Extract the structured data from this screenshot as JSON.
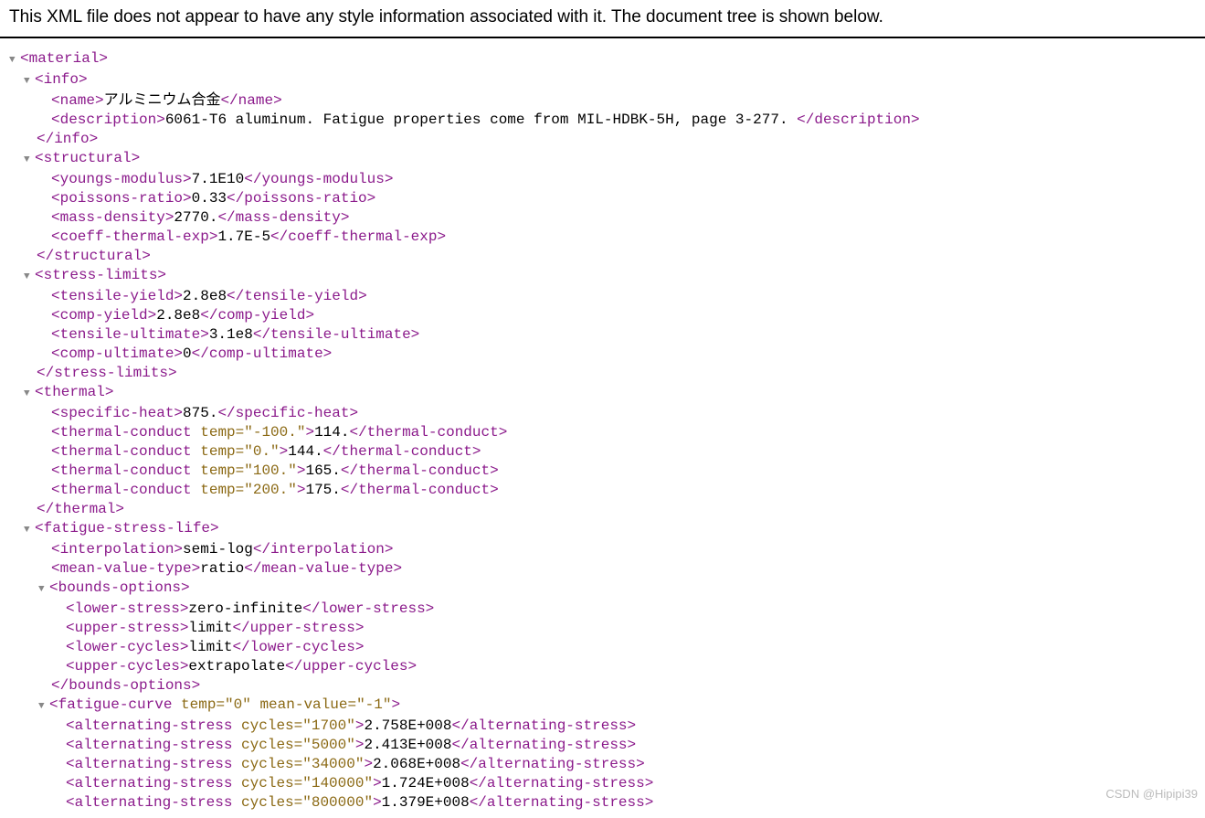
{
  "banner": "This XML file does not appear to have any style information associated with it. The document tree is shown below.",
  "watermark": "CSDN @Hipipi39",
  "tree": [
    {
      "indent": 0,
      "arrow": true,
      "open": "<material>"
    },
    {
      "indent": 1,
      "arrow": true,
      "open": "<info>"
    },
    {
      "indent": 2,
      "open": "<name>",
      "text": "アルミニウム合金",
      "close": "</name>"
    },
    {
      "indent": 2,
      "open": "<description>",
      "text": "6061-T6 aluminum. Fatigue properties come from MIL-HDBK-5H, page 3-277. ",
      "close": "</description>"
    },
    {
      "indent": 1,
      "open": "</info>"
    },
    {
      "indent": 1,
      "arrow": true,
      "open": "<structural>"
    },
    {
      "indent": 2,
      "open": "<youngs-modulus>",
      "text": "7.1E10",
      "close": "</youngs-modulus>"
    },
    {
      "indent": 2,
      "open": "<poissons-ratio>",
      "text": "0.33",
      "close": "</poissons-ratio>"
    },
    {
      "indent": 2,
      "open": "<mass-density>",
      "text": "2770.",
      "close": "</mass-density>"
    },
    {
      "indent": 2,
      "open": "<coeff-thermal-exp>",
      "text": "1.7E-5",
      "close": "</coeff-thermal-exp>"
    },
    {
      "indent": 1,
      "open": "</structural>"
    },
    {
      "indent": 1,
      "arrow": true,
      "open": "<stress-limits>"
    },
    {
      "indent": 2,
      "open": "<tensile-yield>",
      "text": "2.8e8",
      "close": "</tensile-yield>"
    },
    {
      "indent": 2,
      "open": "<comp-yield>",
      "text": "2.8e8",
      "close": "</comp-yield>"
    },
    {
      "indent": 2,
      "open": "<tensile-ultimate>",
      "text": "3.1e8",
      "close": "</tensile-ultimate>"
    },
    {
      "indent": 2,
      "open": "<comp-ultimate>",
      "text": "0",
      "close": "</comp-ultimate>"
    },
    {
      "indent": 1,
      "open": "</stress-limits>"
    },
    {
      "indent": 1,
      "arrow": true,
      "open": "<thermal>"
    },
    {
      "indent": 2,
      "open": "<specific-heat>",
      "text": "875.",
      "close": "</specific-heat>"
    },
    {
      "indent": 2,
      "open": "<thermal-conduct ",
      "attr": "temp=\"-100.\"",
      "openEnd": ">",
      "text": "114.",
      "close": "</thermal-conduct>"
    },
    {
      "indent": 2,
      "open": "<thermal-conduct ",
      "attr": "temp=\"0.\"",
      "openEnd": ">",
      "text": "144.",
      "close": "</thermal-conduct>"
    },
    {
      "indent": 2,
      "open": "<thermal-conduct ",
      "attr": "temp=\"100.\"",
      "openEnd": ">",
      "text": "165.",
      "close": "</thermal-conduct>"
    },
    {
      "indent": 2,
      "open": "<thermal-conduct ",
      "attr": "temp=\"200.\"",
      "openEnd": ">",
      "text": "175.",
      "close": "</thermal-conduct>"
    },
    {
      "indent": 1,
      "open": "</thermal>"
    },
    {
      "indent": 1,
      "arrow": true,
      "open": "<fatigue-stress-life>"
    },
    {
      "indent": 2,
      "open": "<interpolation>",
      "text": "semi-log",
      "close": "</interpolation>"
    },
    {
      "indent": 2,
      "open": "<mean-value-type>",
      "text": "ratio",
      "close": "</mean-value-type>"
    },
    {
      "indent": 2,
      "arrow": true,
      "open": "<bounds-options>"
    },
    {
      "indent": 3,
      "open": "<lower-stress>",
      "text": "zero-infinite",
      "close": "</lower-stress>"
    },
    {
      "indent": 3,
      "open": "<upper-stress>",
      "text": "limit",
      "close": "</upper-stress>"
    },
    {
      "indent": 3,
      "open": "<lower-cycles>",
      "text": "limit",
      "close": "</lower-cycles>"
    },
    {
      "indent": 3,
      "open": "<upper-cycles>",
      "text": "extrapolate",
      "close": "</upper-cycles>"
    },
    {
      "indent": 2,
      "open": "</bounds-options>"
    },
    {
      "indent": 2,
      "arrow": true,
      "open": "<fatigue-curve ",
      "attr": "temp=\"0\" mean-value=\"-1\"",
      "openEnd": ">"
    },
    {
      "indent": 3,
      "open": "<alternating-stress ",
      "attr": "cycles=\"1700\"",
      "openEnd": ">",
      "text": "2.758E+008",
      "close": "</alternating-stress>"
    },
    {
      "indent": 3,
      "open": "<alternating-stress ",
      "attr": "cycles=\"5000\"",
      "openEnd": ">",
      "text": "2.413E+008",
      "close": "</alternating-stress>"
    },
    {
      "indent": 3,
      "open": "<alternating-stress ",
      "attr": "cycles=\"34000\"",
      "openEnd": ">",
      "text": "2.068E+008",
      "close": "</alternating-stress>"
    },
    {
      "indent": 3,
      "open": "<alternating-stress ",
      "attr": "cycles=\"140000\"",
      "openEnd": ">",
      "text": "1.724E+008",
      "close": "</alternating-stress>"
    },
    {
      "indent": 3,
      "open": "<alternating-stress ",
      "attr": "cycles=\"800000\"",
      "openEnd": ">",
      "text": "1.379E+008",
      "close": "</alternating-stress>"
    }
  ]
}
